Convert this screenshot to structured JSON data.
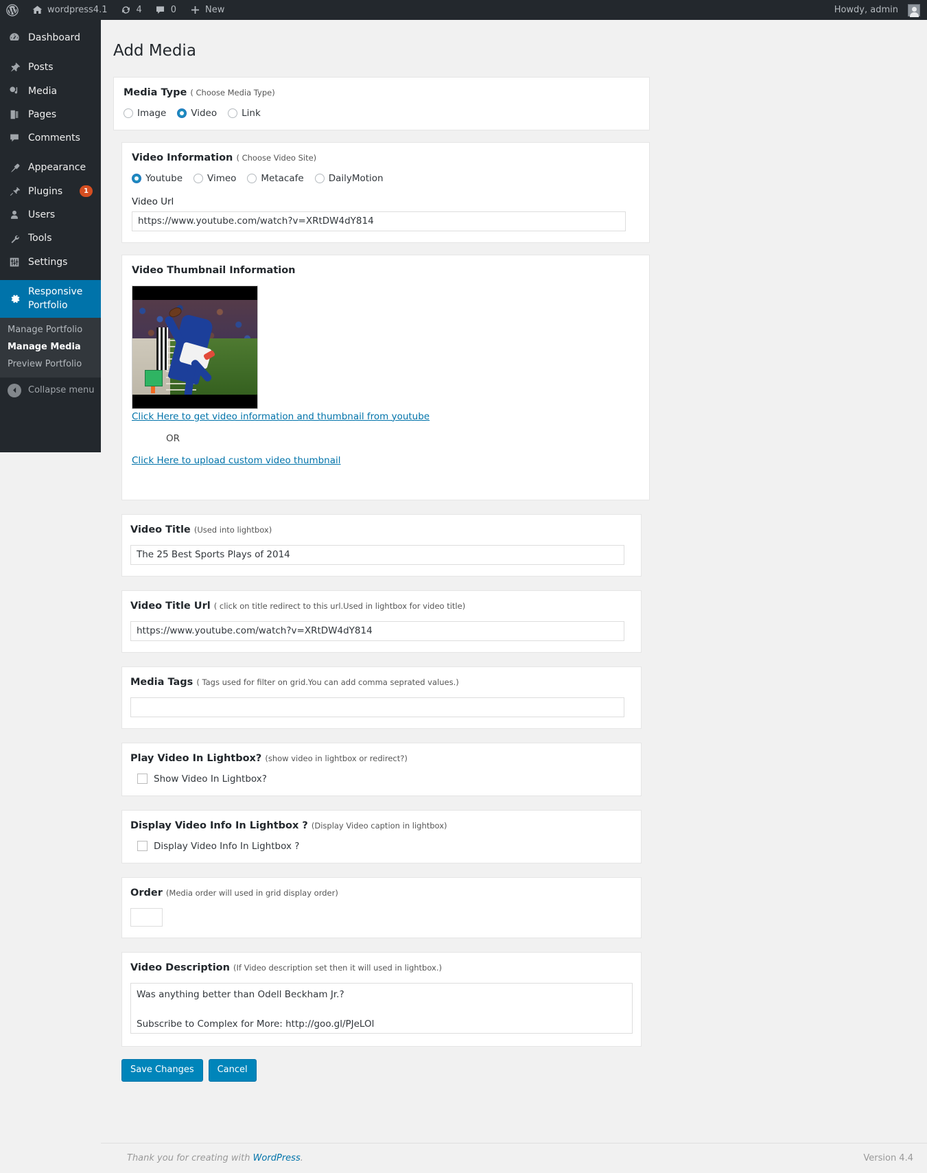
{
  "adminbar": {
    "site_name": "wordpress4.1",
    "updates_count": "4",
    "comments_count": "0",
    "new_label": "New",
    "howdy": "Howdy, admin",
    "icons": {
      "wp_logo": "wordpress-logo-icon",
      "home": "home-icon",
      "updates": "updates-icon",
      "comments": "comment-icon",
      "new": "plus-icon",
      "avatar": "avatar"
    }
  },
  "sidebar": {
    "items": [
      {
        "label": "Dashboard",
        "icon": "dashboard-icon"
      },
      {
        "label": "Posts",
        "icon": "pin-icon"
      },
      {
        "label": "Media",
        "icon": "media-icon"
      },
      {
        "label": "Pages",
        "icon": "page-icon"
      },
      {
        "label": "Comments",
        "icon": "comment-icon"
      },
      {
        "label": "Appearance",
        "icon": "brush-icon"
      },
      {
        "label": "Plugins",
        "icon": "plug-icon",
        "badge": "1"
      },
      {
        "label": "Users",
        "icon": "user-icon"
      },
      {
        "label": "Tools",
        "icon": "wrench-icon"
      },
      {
        "label": "Settings",
        "icon": "sliders-icon"
      },
      {
        "label": "Responsive Portfolio",
        "icon": "gear-icon",
        "current": true
      }
    ],
    "submenu": [
      {
        "label": "Manage Portfolio"
      },
      {
        "label": "Manage Media",
        "current": true
      },
      {
        "label": "Preview Portfolio"
      }
    ],
    "collapse_label": "Collapse menu"
  },
  "page": {
    "title": "Add Media"
  },
  "media_type": {
    "title": "Media Type",
    "hint": "( Choose Media Type)",
    "options": [
      {
        "label": "Image",
        "checked": false
      },
      {
        "label": "Video",
        "checked": true
      },
      {
        "label": "Link",
        "checked": false
      }
    ]
  },
  "video_information": {
    "title": "Video Information",
    "hint": "( Choose Video Site)",
    "sites": [
      {
        "label": "Youtube",
        "checked": true
      },
      {
        "label": "Vimeo",
        "checked": false
      },
      {
        "label": "Metacafe",
        "checked": false
      },
      {
        "label": "DailyMotion",
        "checked": false
      }
    ],
    "url_label": "Video Url",
    "url_value": "https://www.youtube.com/watch?v=XRtDW4dY814",
    "url_placeholder": ""
  },
  "thumbnail": {
    "title": "Video Thumbnail Information",
    "image_alt": "video-thumbnail-preview",
    "fetch_link": "Click Here to get video information and thumbnail from youtube ",
    "or_text": "OR",
    "upload_link": "Click Here to upload custom video thumbnail"
  },
  "video_title": {
    "title": "Video Title",
    "hint": "(Used into lightbox)",
    "value": "The 25 Best Sports Plays of 2014",
    "placeholder": ""
  },
  "video_title_url": {
    "title": "Video Title Url",
    "hint": "( click on title redirect to this url.Used in lightbox for video title)",
    "value": "https://www.youtube.com/watch?v=XRtDW4dY814",
    "placeholder": ""
  },
  "media_tags": {
    "title": "Media Tags",
    "hint": "( Tags used for filter on grid.You can add comma seprated values.)",
    "value": "",
    "placeholder": ""
  },
  "play_lightbox": {
    "title": "Play Video In Lightbox?",
    "hint": "(show video in lightbox or redirect?)",
    "checkbox_label": "Show Video In Lightbox?",
    "checked": false
  },
  "display_info_lightbox": {
    "title": "Display Video Info In Lightbox ?",
    "hint": "(Display Video caption in lightbox)",
    "checkbox_label": "Display Video Info In Lightbox ?",
    "checked": false
  },
  "order": {
    "title": "Order",
    "hint": "(Media order will used in grid display order)",
    "value": "",
    "placeholder": ""
  },
  "video_description": {
    "title": "Video Description",
    "hint": "(If Video description set then it will used in lightbox.)",
    "value": "Was anything better than Odell Beckham Jr.?\n\nSubscribe to Complex for More: http://goo.gl/PJeLOl\nCheck out more of Complex here:",
    "placeholder": ""
  },
  "actions": {
    "save_label": "Save Changes",
    "cancel_label": "Cancel"
  },
  "footer": {
    "thanks_prefix": "Thank you for creating with ",
    "wordpress_link": "WordPress",
    "thanks_suffix": ".",
    "version": "Version 4.4"
  },
  "colors": {
    "accent": "#0073aa",
    "admin_bg": "#23282d",
    "submenu_bg": "#32373c",
    "badge": "#d54e21",
    "link": "#0073aa"
  }
}
